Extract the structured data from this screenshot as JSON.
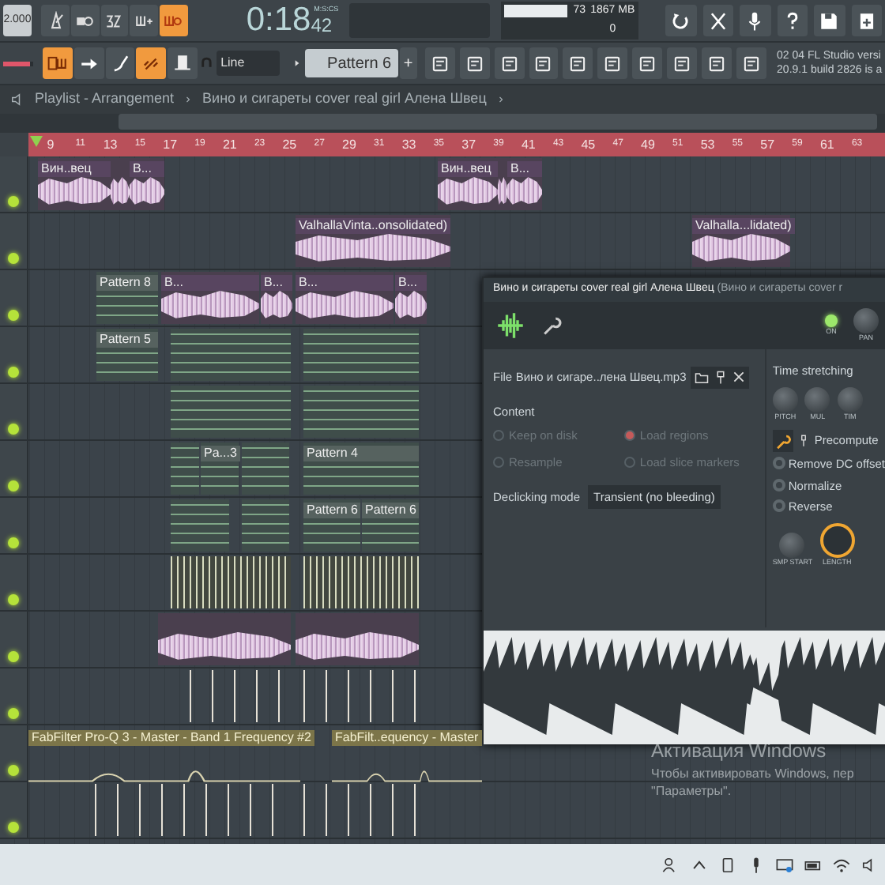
{
  "toolbar": {
    "tempo": "2.000",
    "volume": {
      "level": 0.9
    },
    "time_unit": "M:S:CS",
    "time": "0:18",
    "time_cs": "42",
    "cpu": "73",
    "memory": "1867 MB",
    "polyphony": "0",
    "buttons": [
      {
        "kind": "metronome",
        "on": false
      },
      {
        "kind": "wait",
        "on": false
      },
      {
        "kind": "countdown",
        "on": false
      },
      {
        "kind": "step",
        "on": false
      },
      {
        "kind": "loop",
        "on": true
      }
    ],
    "tools": [
      {
        "kind": "pattern-mode",
        "on": true
      },
      {
        "kind": "arrow",
        "on": false
      },
      {
        "kind": "brush",
        "on": false
      },
      {
        "kind": "link",
        "on": true
      },
      {
        "kind": "hat",
        "on": false
      }
    ],
    "snap": "Line",
    "pattern": "Pattern 6",
    "pattern_add": "+",
    "news": [
      "02 04  FL Studio versi",
      "20.9.1 build 2826 is a"
    ]
  },
  "breadcrumb": [
    "Playlist - Arrangement",
    "Вино и сигареты cover real girl  Алена Швец"
  ],
  "ruler": [
    "9",
    "11",
    "13",
    "15",
    "17",
    "19",
    "21",
    "23",
    "25",
    "27",
    "29",
    "31",
    "33",
    "35",
    "37",
    "39",
    "41",
    "43",
    "45",
    "47",
    "49",
    "51",
    "53",
    "55",
    "57",
    "59",
    "61",
    "63"
  ],
  "tracks": [
    {
      "enabled": true,
      "clips": [
        {
          "kind": "audio",
          "label": "Вин..вец"
        },
        {
          "kind": "audio"
        },
        {
          "kind": "audio",
          "label": "В..."
        },
        {
          "kind": "audio",
          "label": "Вин..вец"
        },
        {
          "kind": "audio"
        },
        {
          "kind": "audio",
          "label": "В..."
        }
      ]
    },
    {
      "enabled": true,
      "clips": [
        {
          "kind": "audio",
          "label": "ValhallaVinta..onsolidated)"
        },
        {
          "kind": "audio",
          "label": "Valhalla...lidated)"
        }
      ]
    },
    {
      "enabled": true,
      "clips": [
        {
          "kind": "pattern",
          "label": "Pattern 8"
        },
        {
          "kind": "audio",
          "label": "В..."
        },
        {
          "kind": "audio",
          "label": "В..."
        },
        {
          "kind": "audio",
          "label": "В..."
        },
        {
          "kind": "audio",
          "label": "В..."
        }
      ]
    },
    {
      "enabled": true,
      "clips": [
        {
          "kind": "pattern",
          "label": "Pattern 5"
        },
        {
          "kind": "pattern"
        },
        {
          "kind": "pattern"
        }
      ]
    },
    {
      "enabled": true,
      "clips": [
        {
          "kind": "pattern"
        },
        {
          "kind": "pattern"
        }
      ]
    },
    {
      "enabled": true,
      "clips": [
        {
          "kind": "pattern"
        },
        {
          "kind": "pattern",
          "label": "Pa...3"
        },
        {
          "kind": "pattern"
        },
        {
          "kind": "pattern",
          "label": "Pattern 4"
        }
      ]
    },
    {
      "enabled": true,
      "clips": [
        {
          "kind": "pattern"
        },
        {
          "kind": "pattern"
        },
        {
          "kind": "pattern",
          "label": "Pattern 6"
        },
        {
          "kind": "pattern",
          "label": "Pattern 6"
        }
      ]
    },
    {
      "enabled": true,
      "clips": [
        {
          "kind": "drums"
        },
        {
          "kind": "drums"
        }
      ]
    },
    {
      "enabled": true,
      "clips": [
        {
          "kind": "audio"
        },
        {
          "kind": "audio"
        }
      ]
    },
    {
      "enabled": true,
      "clips": [
        {
          "kind": "hits"
        },
        {
          "kind": "hits"
        }
      ]
    },
    {
      "enabled": true,
      "clips": [
        {
          "kind": "automation",
          "label": "FabFilter Pro-Q 3 - Master - Band 1 Frequency #2"
        },
        {
          "kind": "automation",
          "label": "FabFilt..equency - Master"
        }
      ]
    },
    {
      "enabled": true,
      "clips": [
        {
          "kind": "hits"
        },
        {
          "kind": "hits"
        }
      ]
    }
  ],
  "plugin": {
    "title": "Вино и сигареты cover real girl  Алена Швец",
    "title_extra": "(Вино и сигареты cover r",
    "power_label": "ON",
    "power_on": true,
    "pan_label": "PAN",
    "file_label": "File",
    "file": "Вино и сигаре..лена Швец.mp3",
    "content_label": "Content",
    "options": [
      {
        "label": "Keep on disk",
        "checked": false
      },
      {
        "label": "Load regions",
        "checked": true
      },
      {
        "label": "Resample",
        "checked": false
      },
      {
        "label": "Load slice markers",
        "checked": false
      }
    ],
    "declicking_label": "Declicking mode",
    "declicking": "Transient (no bleeding)",
    "time_stretching": "Time stretching",
    "stretch_knobs": [
      "PITCH",
      "MUL",
      "TIM"
    ],
    "precompute": "Precompute",
    "effects": [
      {
        "label": "Remove DC offset",
        "checked": false
      },
      {
        "label": "Normalize",
        "checked": false
      },
      {
        "label": "Reverse",
        "checked": false
      }
    ],
    "sample_knobs": [
      {
        "label": "SMP START",
        "selected": false
      },
      {
        "label": "LENGTH",
        "selected": true
      }
    ]
  },
  "activation": {
    "title": "Активация Windows",
    "lines": [
      "Чтобы активировать Windows, пер",
      "\"Параметры\"."
    ]
  }
}
